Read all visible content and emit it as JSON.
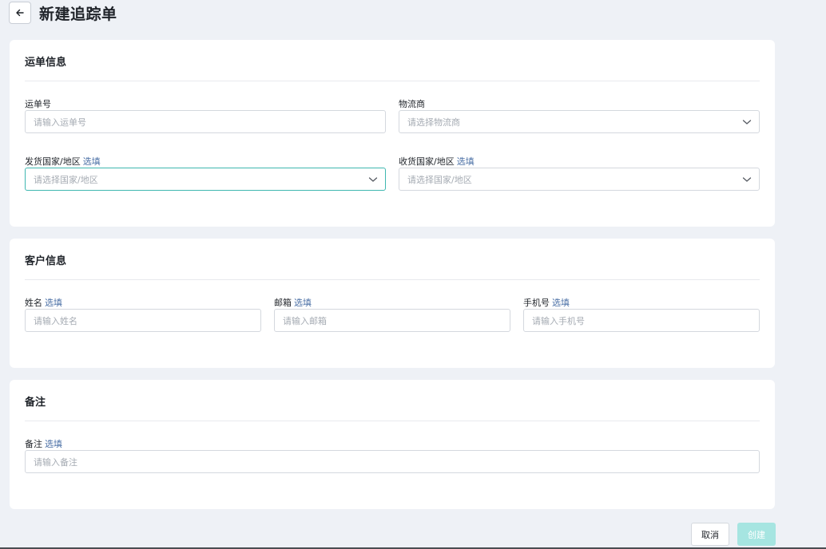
{
  "header": {
    "title": "新建追踪单",
    "back_icon": "arrow-left-icon"
  },
  "waybill": {
    "title": "运单信息",
    "tracking_no": {
      "label": "运单号",
      "placeholder": "请输入运单号"
    },
    "carrier": {
      "label": "物流商",
      "placeholder": "请选择物流商"
    },
    "origin": {
      "label": "发货国家/地区",
      "optional": "选填",
      "placeholder": "请选择国家/地区"
    },
    "destination": {
      "label": "收货国家/地区",
      "optional": "选填",
      "placeholder": "请选择国家/地区"
    }
  },
  "customer": {
    "title": "客户信息",
    "name": {
      "label": "姓名",
      "optional": "选填",
      "placeholder": "请输入姓名"
    },
    "email": {
      "label": "邮箱",
      "optional": "选填",
      "placeholder": "请输入邮箱"
    },
    "phone": {
      "label": "手机号",
      "optional": "选填",
      "placeholder": "请输入手机号"
    }
  },
  "remark": {
    "title": "备注",
    "note": {
      "label": "备注",
      "optional": "选填",
      "placeholder": "请输入备注"
    }
  },
  "footer": {
    "cancel_label": "取消",
    "create_label": "创建"
  },
  "colors": {
    "accent": "#3fb7b0",
    "create_disabled": "#a6e5e1",
    "optional_text": "#4a6fa5"
  }
}
